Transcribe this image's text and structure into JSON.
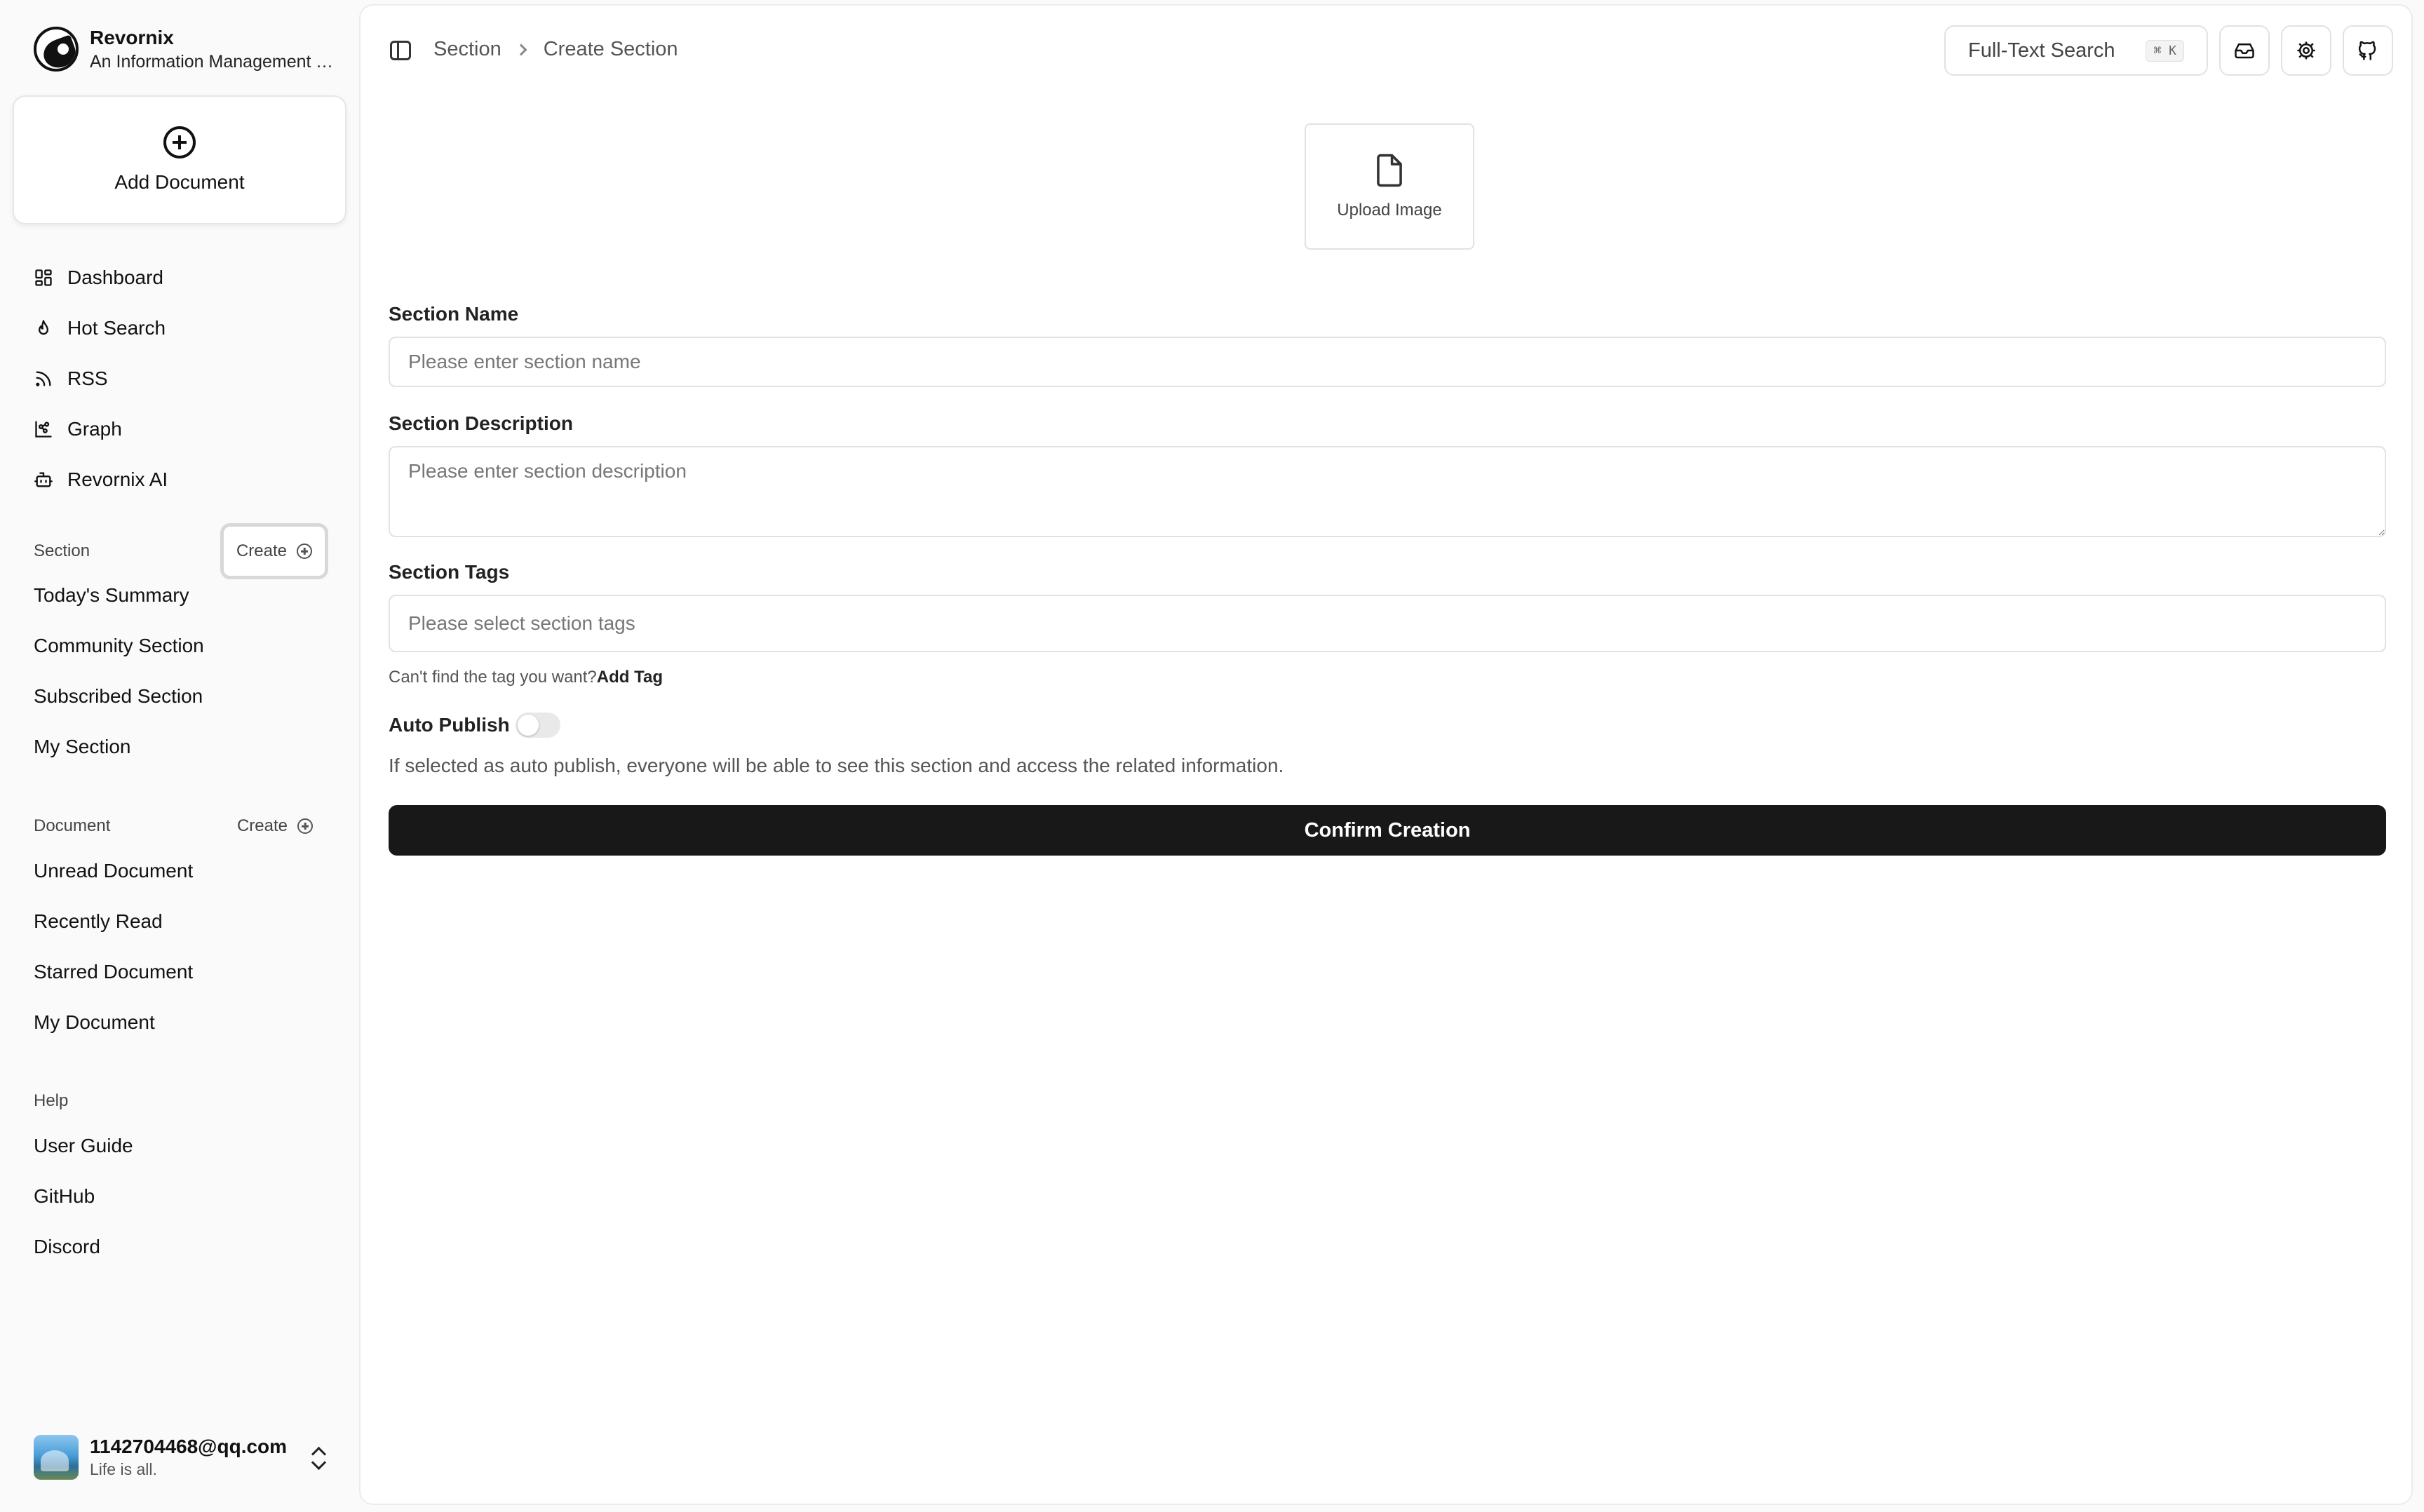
{
  "brand": {
    "name": "Revornix",
    "subtitle": "An Information Management Tool"
  },
  "add_document": {
    "label": "Add Document"
  },
  "nav": [
    {
      "label": "Dashboard",
      "icon": "grid-icon"
    },
    {
      "label": "Hot Search",
      "icon": "flame-icon"
    },
    {
      "label": "RSS",
      "icon": "rss-icon"
    },
    {
      "label": "Graph",
      "icon": "graph-icon"
    },
    {
      "label": "Revornix AI",
      "icon": "bot-icon"
    }
  ],
  "section_group": {
    "title": "Section",
    "create_label": "Create",
    "items": [
      "Today's Summary",
      "Community Section",
      "Subscribed Section",
      "My Section"
    ]
  },
  "document_group": {
    "title": "Document",
    "create_label": "Create",
    "items": [
      "Unread Document",
      "Recently Read",
      "Starred Document",
      "My Document"
    ]
  },
  "help_group": {
    "title": "Help",
    "items": [
      "User Guide",
      "GitHub",
      "Discord"
    ]
  },
  "user": {
    "email": "1142704468@qq.com",
    "motto": "Life is all."
  },
  "breadcrumb": {
    "parent": "Section",
    "current": "Create Section"
  },
  "header": {
    "search_label": "Full-Text Search",
    "search_shortcut": "⌘ K",
    "icons": [
      "inbox-icon",
      "gear-icon",
      "github-icon"
    ]
  },
  "form": {
    "upload_label": "Upload Image",
    "name_label": "Section Name",
    "name_placeholder": "Please enter section name",
    "name_value": "",
    "description_label": "Section Description",
    "description_placeholder": "Please enter section description",
    "description_value": "",
    "tags_label": "Section Tags",
    "tags_placeholder": "Please select section tags",
    "tags_hint": "Can't find the tag you want?",
    "add_tag_label": "Add Tag",
    "auto_publish_label": "Auto Publish",
    "auto_publish_on": false,
    "auto_publish_desc": "If selected as auto publish, everyone will be able to see this section and access the related information.",
    "confirm_label": "Confirm Creation"
  }
}
